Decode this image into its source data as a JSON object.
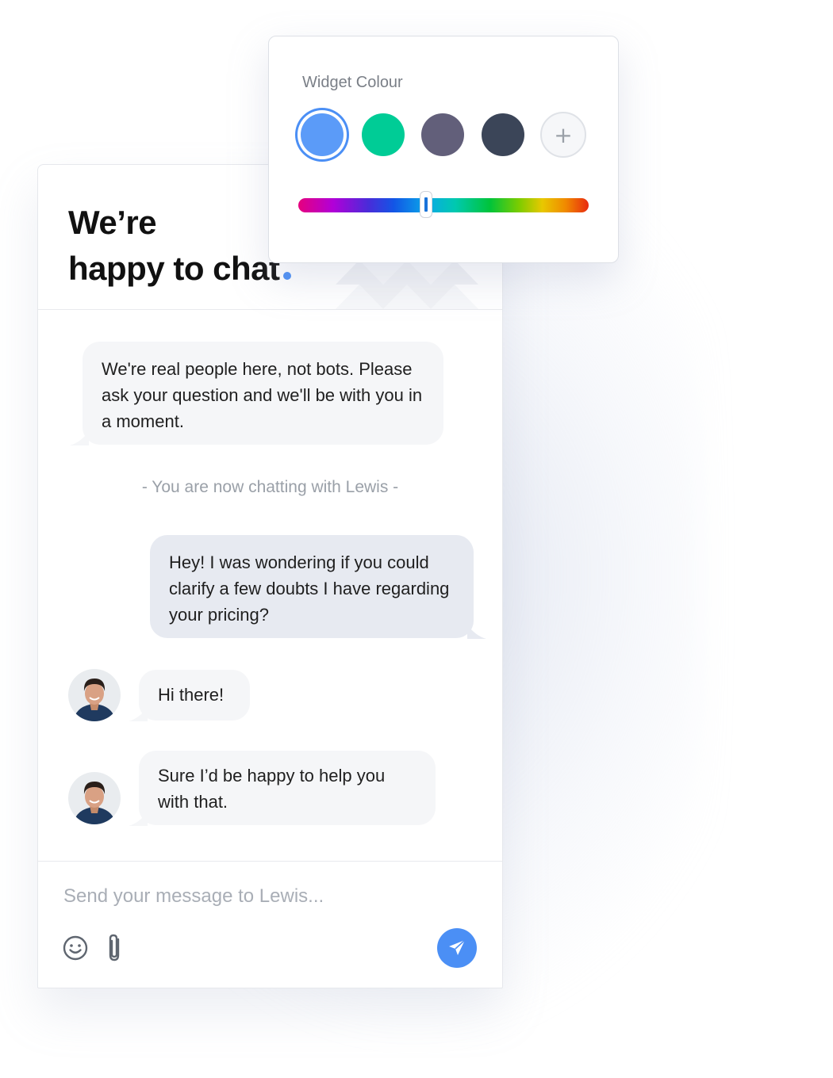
{
  "header": {
    "title_line1": "We’re",
    "title_line2": "happy to chat"
  },
  "picker": {
    "title": "Widget Colour",
    "swatches": [
      {
        "name": "blue",
        "color": "#5b9bf8",
        "selected": true
      },
      {
        "name": "green",
        "color": "#00cc96",
        "selected": false
      },
      {
        "name": "purple-grey",
        "color": "#625f7a",
        "selected": false
      },
      {
        "name": "slate",
        "color": "#3b4558",
        "selected": false
      }
    ],
    "add_label": "+",
    "hue_value": 0.44
  },
  "messages": [
    {
      "from": "agent",
      "text": "We're real people here, not bots. Please ask your question and we'll be with you in a moment."
    },
    {
      "from": "system",
      "text": "- You are now chatting with Lewis -"
    },
    {
      "from": "user",
      "text": "Hey! I was wondering if you could clarify a few doubts I have regarding your pricing?"
    },
    {
      "from": "agent",
      "text": "Hi there!"
    },
    {
      "from": "agent",
      "text": "Sure I’d be happy to help you with that."
    }
  ],
  "composer": {
    "placeholder": "Send your message to Lewis...",
    "icons": [
      "smiley-icon",
      "paperclip-icon",
      "send-icon"
    ]
  },
  "colors": {
    "accent": "#4b8ff5"
  }
}
